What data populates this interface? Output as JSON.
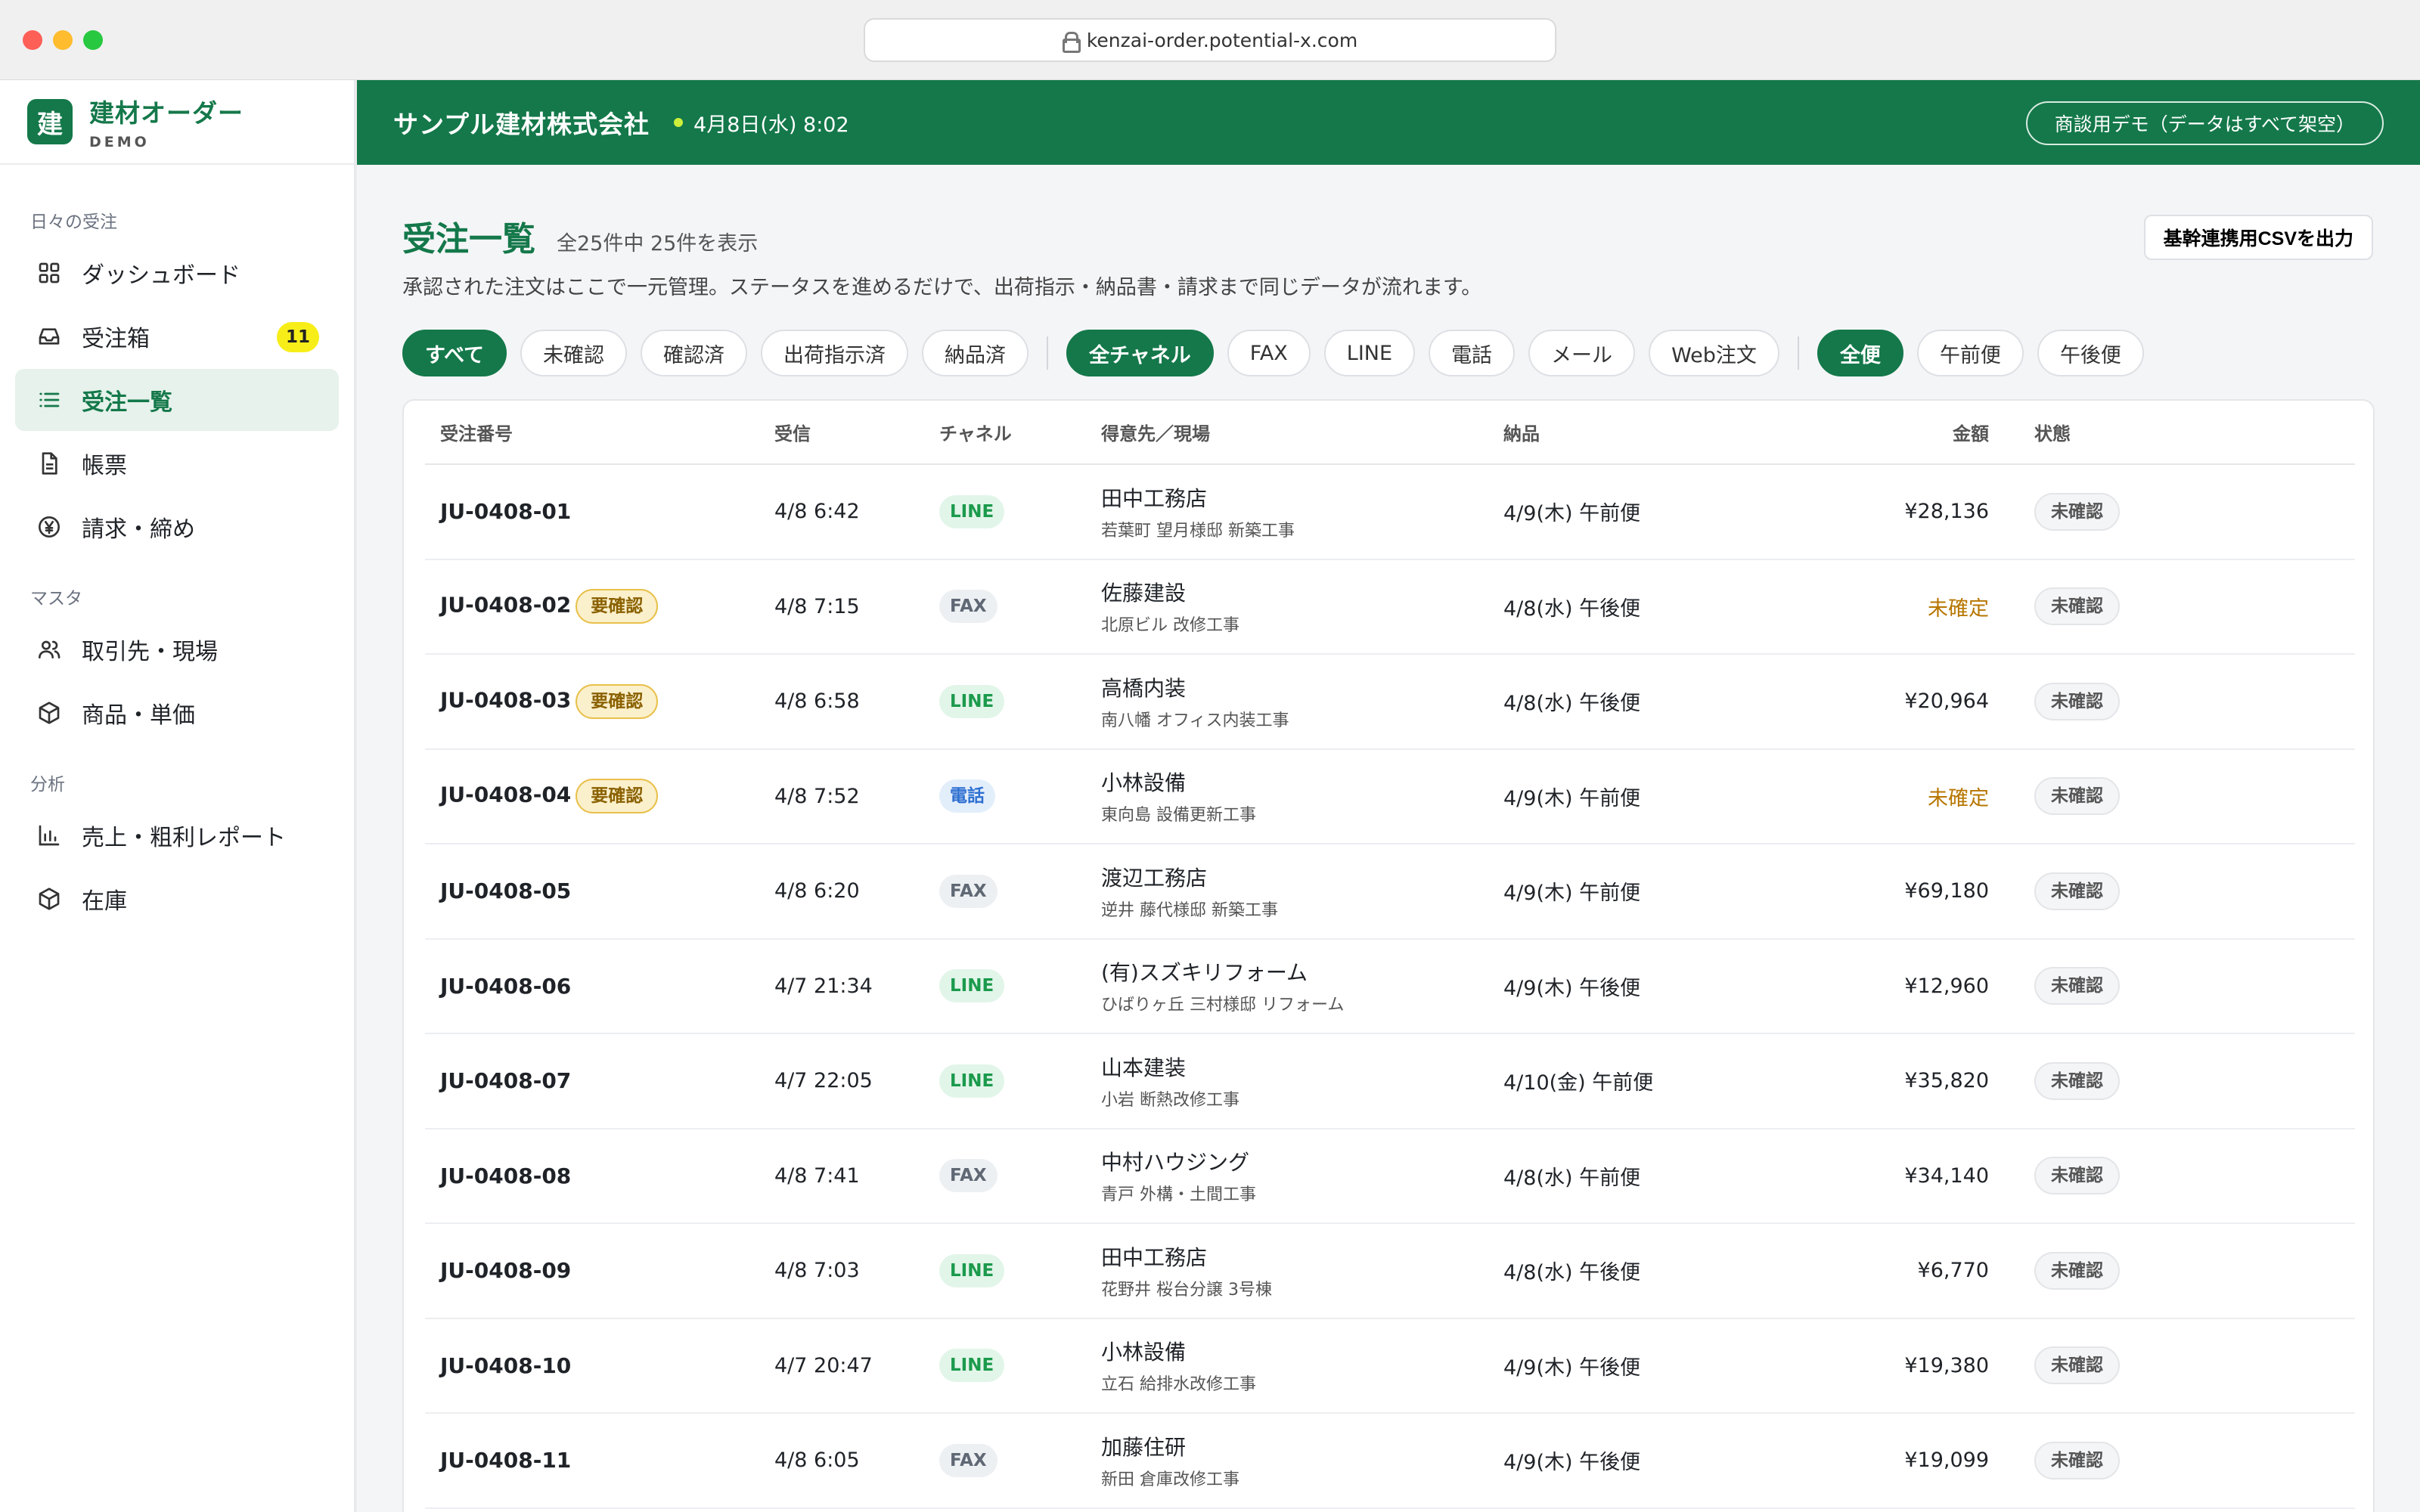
{
  "browser": {
    "url": "kenzai-order.potential-x.com"
  },
  "brand": {
    "logo": "建",
    "name": "建材オーダー",
    "sub": "DEMO"
  },
  "sidebar": {
    "sections": [
      {
        "title": "日々の受注",
        "items": [
          {
            "label": "ダッシュボード",
            "icon": "dashboard-icon"
          },
          {
            "label": "受注箱",
            "icon": "inbox-icon",
            "badge": "11"
          },
          {
            "label": "受注一覧",
            "icon": "list-icon",
            "active": true
          },
          {
            "label": "帳票",
            "icon": "document-icon"
          },
          {
            "label": "請求・締め",
            "icon": "yen-icon"
          }
        ]
      },
      {
        "title": "マスタ",
        "items": [
          {
            "label": "取引先・現場",
            "icon": "users-icon"
          },
          {
            "label": "商品・単価",
            "icon": "box-icon"
          }
        ]
      },
      {
        "title": "分析",
        "items": [
          {
            "label": "売上・粗利レポート",
            "icon": "bar-chart-icon"
          },
          {
            "label": "在庫",
            "icon": "box-icon"
          }
        ]
      }
    ]
  },
  "header": {
    "company": "サンプル建材株式会社",
    "datetime": "4月8日(水) 8:02",
    "demo_label": "商談用デモ（データはすべて架空）"
  },
  "main": {
    "title": "受注一覧",
    "count": "全25件中 25件を表示",
    "csv_button": "基幹連携用CSVを出力",
    "description": "承認された注文はここで一元管理。ステータスを進めるだけで、出荷指示・納品書・請求まで同じデータが流れます。",
    "filters": {
      "status": [
        {
          "label": "すべて",
          "on": true
        },
        {
          "label": "未確認"
        },
        {
          "label": "確認済"
        },
        {
          "label": "出荷指示済"
        },
        {
          "label": "納品済"
        }
      ],
      "channel": [
        {
          "label": "全チャネル",
          "on": true
        },
        {
          "label": "FAX"
        },
        {
          "label": "LINE"
        },
        {
          "label": "電話"
        },
        {
          "label": "メール"
        },
        {
          "label": "Web注文"
        }
      ],
      "delivery": [
        {
          "label": "全便",
          "on": true
        },
        {
          "label": "午前便"
        },
        {
          "label": "午後便"
        }
      ]
    },
    "table": {
      "columns": [
        "受注番号",
        "受信",
        "チャネル",
        "得意先／現場",
        "納品",
        "金額",
        "状態"
      ],
      "rows": [
        {
          "id": "JU-0408-01",
          "flag": "",
          "received": "4/8 6:42",
          "channel": "LINE",
          "customer": "田中工務店",
          "site": "若葉町 望月様邸 新築工事",
          "delivery": "4/9(木) 午前便",
          "amount": "¥28,136",
          "status": "未確認"
        },
        {
          "id": "JU-0408-02",
          "flag": "要確認",
          "received": "4/8 7:15",
          "channel": "FAX",
          "customer": "佐藤建設",
          "site": "北原ビル 改修工事",
          "delivery": "4/8(水) 午後便",
          "amount": "未確定",
          "status": "未確認"
        },
        {
          "id": "JU-0408-03",
          "flag": "要確認",
          "received": "4/8 6:58",
          "channel": "LINE",
          "customer": "高橋内装",
          "site": "南八幡 オフィス内装工事",
          "delivery": "4/8(水) 午後便",
          "amount": "¥20,964",
          "status": "未確認"
        },
        {
          "id": "JU-0408-04",
          "flag": "要確認",
          "received": "4/8 7:52",
          "channel": "電話",
          "customer": "小林設備",
          "site": "東向島 設備更新工事",
          "delivery": "4/9(木) 午前便",
          "amount": "未確定",
          "status": "未確認"
        },
        {
          "id": "JU-0408-05",
          "flag": "",
          "received": "4/8 6:20",
          "channel": "FAX",
          "customer": "渡辺工務店",
          "site": "逆井 藤代様邸 新築工事",
          "delivery": "4/9(木) 午前便",
          "amount": "¥69,180",
          "status": "未確認"
        },
        {
          "id": "JU-0408-06",
          "flag": "",
          "received": "4/7 21:34",
          "channel": "LINE",
          "customer": "(有)スズキリフォーム",
          "site": "ひばりヶ丘 三村様邸 リフォーム",
          "delivery": "4/9(木) 午後便",
          "amount": "¥12,960",
          "status": "未確認"
        },
        {
          "id": "JU-0408-07",
          "flag": "",
          "received": "4/7 22:05",
          "channel": "LINE",
          "customer": "山本建装",
          "site": "小岩 断熱改修工事",
          "delivery": "4/10(金) 午前便",
          "amount": "¥35,820",
          "status": "未確認"
        },
        {
          "id": "JU-0408-08",
          "flag": "",
          "received": "4/8 7:41",
          "channel": "FAX",
          "customer": "中村ハウジング",
          "site": "青戸 外構・土間工事",
          "delivery": "4/8(水) 午前便",
          "amount": "¥34,140",
          "status": "未確認"
        },
        {
          "id": "JU-0408-09",
          "flag": "",
          "received": "4/8 7:03",
          "channel": "LINE",
          "customer": "田中工務店",
          "site": "花野井 桜台分譲 3号棟",
          "delivery": "4/8(水) 午後便",
          "amount": "¥6,770",
          "status": "未確認"
        },
        {
          "id": "JU-0408-10",
          "flag": "",
          "received": "4/7 20:47",
          "channel": "LINE",
          "customer": "小林設備",
          "site": "立石 給排水改修工事",
          "delivery": "4/9(木) 午後便",
          "amount": "¥19,380",
          "status": "未確認"
        },
        {
          "id": "JU-0408-11",
          "flag": "",
          "received": "4/8 6:05",
          "channel": "FAX",
          "customer": "加藤住研",
          "site": "新田 倉庫改修工事",
          "delivery": "4/9(木) 午後便",
          "amount": "¥19,099",
          "status": "未確認"
        }
      ]
    }
  },
  "colors": {
    "brand": "#14784a",
    "badge": "#f7ee19",
    "warn_bg": "#fbf0cc",
    "pending": "#b77600"
  }
}
